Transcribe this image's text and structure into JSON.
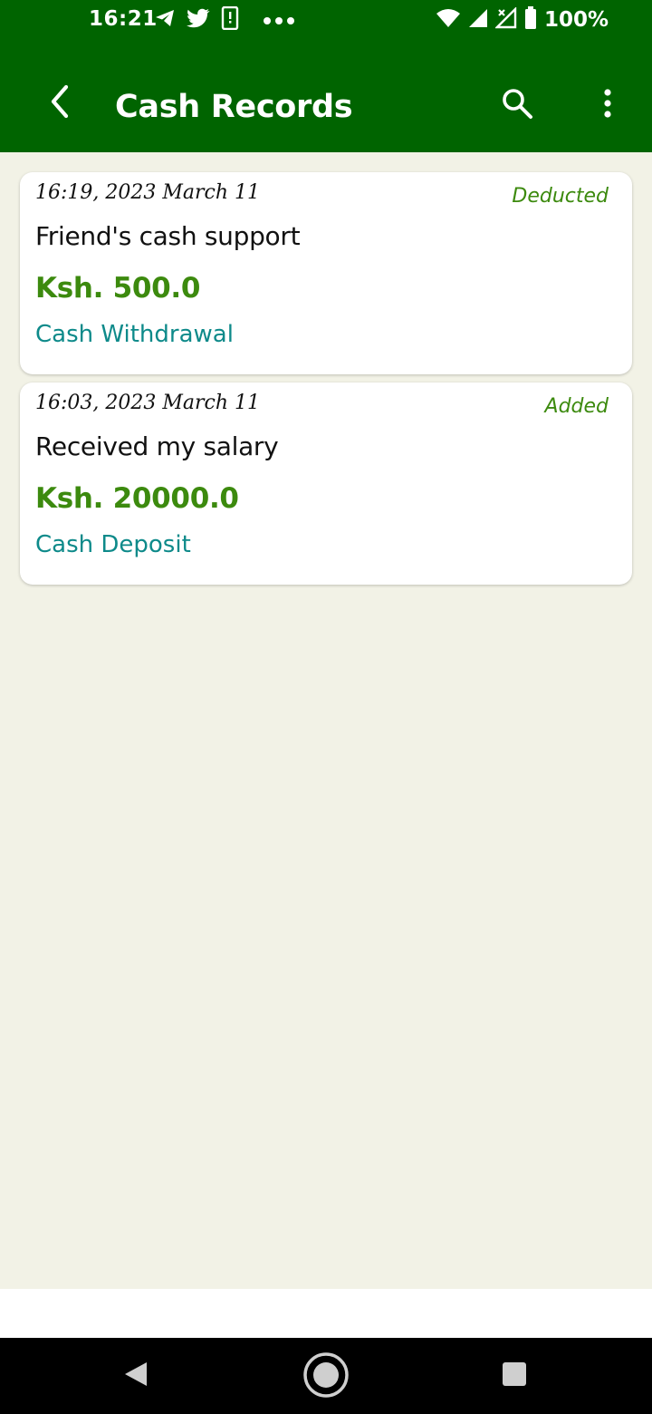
{
  "status_bar": {
    "time": "16:21",
    "battery": "100%",
    "left_icons": [
      "telegram-icon",
      "twitter-icon",
      "device-alert-icon",
      "more-dots-icon"
    ],
    "right_icons": [
      "wifi-icon",
      "signal-icon",
      "signal-x-icon",
      "battery-icon"
    ]
  },
  "app_bar": {
    "title": "Cash Records",
    "background": "#006400",
    "icons": [
      "back-arrow-icon",
      "search-icon",
      "overflow-menu-icon"
    ]
  },
  "records": [
    {
      "timestamp": "16:19, 2023 March 11",
      "status": "Deducted",
      "description": "Friend's cash support",
      "amount": "Ksh. 500.0",
      "type": "Cash Withdrawal"
    },
    {
      "timestamp": "16:03, 2023 March 11",
      "status": "Added",
      "description": "Received my salary",
      "amount": "Ksh. 20000.0",
      "type": "Cash Deposit"
    }
  ],
  "colors": {
    "accent_green": "#3C8A0E",
    "teal": "#0E8A8A",
    "background": "#F2F2E6"
  },
  "nav_bar": {
    "icons": [
      "nav-back-icon",
      "nav-home-icon",
      "nav-recents-icon"
    ]
  }
}
